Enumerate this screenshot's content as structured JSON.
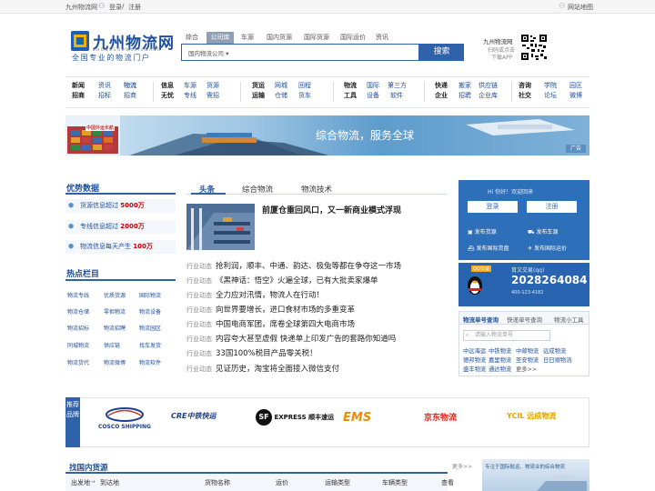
{
  "topbar": {
    "site": "九州物流网",
    "login": "登录",
    "sep": "/",
    "register": "注册",
    "sitemap": "网站地图"
  },
  "logo": {
    "title": "九州物流网",
    "en": "ZHONGGUOWULIUWANG",
    "sub": "全国专业的物流门户"
  },
  "search": {
    "tabs": [
      "综合",
      "公司库",
      "车源",
      "国内货源",
      "国际货源",
      "国际运价",
      "资讯"
    ],
    "active_tab": 1,
    "select": "国内物流公司",
    "button": "搜索"
  },
  "app": {
    "title": "九州物流网",
    "line1": "扫码或点击",
    "line2": "下载APP"
  },
  "nav": [
    {
      "h": [
        "新闻",
        "招商"
      ],
      "l": [
        [
          "资讯",
          "物流",
          "媒体"
        ],
        [
          "招标",
          "招商",
          "加盟"
        ]
      ]
    },
    {
      "h": [
        "信息",
        "无忧"
      ],
      "l": [
        [
          "车源",
          "货源"
        ],
        [
          "专线",
          "需招"
        ]
      ]
    },
    {
      "h": [
        "货运",
        "运输"
      ],
      "l": [
        [
          "网城",
          "回程"
        ],
        [
          "仓储",
          "货车"
        ]
      ]
    },
    {
      "h": [
        "物流",
        "工具"
      ],
      "l": [
        [
          "国际",
          "第三方"
        ],
        [
          "设备",
          "软件"
        ]
      ]
    },
    {
      "h": [
        "快递",
        "企业"
      ],
      "l": [
        [
          "搬家",
          "供应链"
        ],
        [
          "招聘",
          "企业库"
        ]
      ]
    },
    {
      "h": [
        "咨询",
        "社交"
      ],
      "l": [
        [
          "学院",
          "园区"
        ],
        [
          "论坛",
          "微博"
        ]
      ]
    }
  ],
  "banner": {
    "text": "综合物流，服务全球",
    "badge": "广告",
    "logo_text": "中国外运长航"
  },
  "advantage": {
    "title": "优势数据",
    "items": [
      {
        "label": "货源信息超过",
        "value": "5000万"
      },
      {
        "label": "专线信息超过",
        "value": "2000万"
      },
      {
        "label": "物流信息每天产生",
        "value": "100万"
      }
    ]
  },
  "hot": {
    "title": "热点栏目",
    "items": [
      "物流专线",
      "优质货源",
      "国际物流",
      "物流仓储",
      "零担物流",
      "物流设备",
      "物流招标",
      "物流招聘",
      "物流园区",
      "同城物流",
      "供应链",
      "找车发货",
      "物流货代",
      "物流微博",
      "物流软件"
    ]
  },
  "middle": {
    "tabs": [
      "头条",
      "综合物流",
      "物流技术"
    ],
    "headline": "前厦仓重回风口，又一新商业模式浮现",
    "news": [
      {
        "cat": "行业动态",
        "title": "抢利润，顺丰、中通、韵达、极兔等都在争夺这一市场"
      },
      {
        "cat": "行业动态",
        "title": "《黑神话：悟空》火遍全球，已有大批卖家爆单"
      },
      {
        "cat": "行业动态",
        "title": "全力应对汛情，物流人在行动！"
      },
      {
        "cat": "行业动态",
        "title": "向世界要增长，进口食材市场的多重变革"
      },
      {
        "cat": "行业动态",
        "title": "中国电商军团，席卷全球第四大电商市场"
      },
      {
        "cat": "行业动态",
        "title": "内容夸大甚至虚假 快递单上印发广告的套路你知道吗"
      },
      {
        "cat": "行业动态",
        "title": "33国100%税目产品零关税！"
      },
      {
        "cat": "行业动态",
        "title": "见证历史，淘宝将全面接入微信支付"
      }
    ]
  },
  "userbox": {
    "greet": "Hi  你好！欢迎回来",
    "login": "登录",
    "register": "注册",
    "actions": [
      "发布货源",
      "发布车源",
      "发布国际货盘",
      "发布国际运价"
    ]
  },
  "qq": {
    "badge": "QQ交谈",
    "label": "育文交易(qq)",
    "number": "2028264084",
    "phone": "400-123-4182"
  },
  "tools": {
    "tabs": [
      "物流单号查询",
      "快递单号查询",
      "物流小工具"
    ],
    "placeholder": "请输入物流单号",
    "links": [
      "中远海运",
      "中铁物流",
      "中邮物流",
      "远成物流",
      "德邦物流",
      "嘉里物流",
      "圣安物流",
      "日日顺物流",
      "盛丰物流",
      "通达物流",
      "更多>>"
    ]
  },
  "brands": {
    "label": "推荐品牌",
    "items": [
      "COSCO SHIPPING",
      "CRE中铁快运",
      "EXPRESS 顺丰速运",
      "EMS",
      "京东物流",
      "YCIL 远成物流"
    ]
  },
  "domestic": {
    "title": "找国内货源",
    "more": "更多>>",
    "cols": [
      "出发地",
      "→",
      "到达地",
      "货物名称",
      "运价",
      "运输类型",
      "车辆类型",
      "查看"
    ]
  },
  "sidead": {
    "text": "专注于国际航运、物流业的综合物流"
  },
  "colors": {
    "brand": "#2f62a8",
    "accent": "#c00000"
  }
}
